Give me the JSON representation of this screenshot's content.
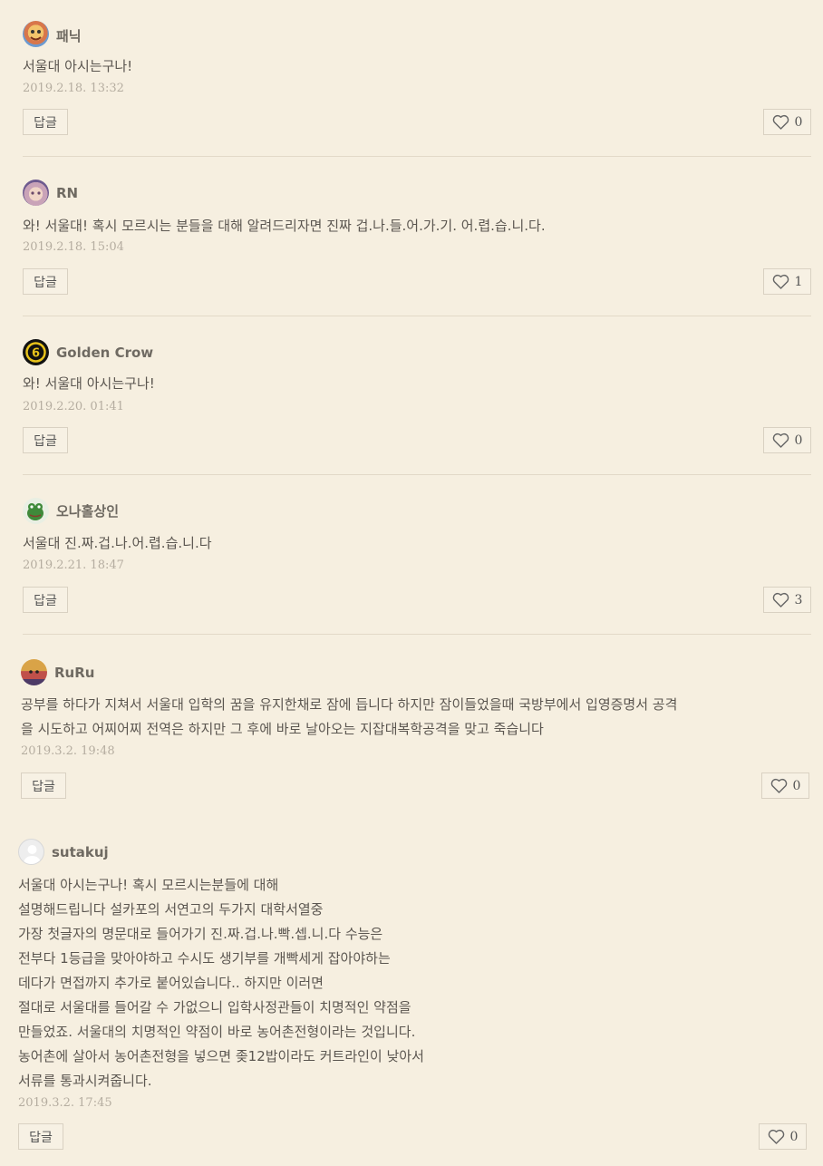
{
  "comments": [
    {
      "author": "패닉",
      "avatar_icon": "cartoon-character-avatar",
      "text": "서울대 아시는구나!",
      "time": "2019.2.18. 13:32",
      "reply_label": "답글",
      "likes": "0"
    },
    {
      "author": "RN",
      "avatar_icon": "anime-character-avatar",
      "text": "와! 서울대! 혹시 모르시는 분들을 대해 알려드리자면 진짜 겁.나.들.어.가.기. 어.렵.습.니.다.",
      "time": "2019.2.18. 15:04",
      "reply_label": "답글",
      "likes": "1"
    },
    {
      "author": "Golden Crow",
      "avatar_icon": "rainbow-six-logo-avatar",
      "text": "와! 서울대 아시는구나!",
      "time": "2019.2.20. 01:41",
      "reply_label": "답글",
      "likes": "0"
    },
    {
      "author": "오나홀상인",
      "avatar_icon": "frog-avatar",
      "text": "서울대 진.짜.겁.나.어.렵.습.니.다",
      "time": "2019.2.21. 18:47",
      "reply_label": "답글",
      "likes": "3"
    },
    {
      "author": "RuRu",
      "avatar_icon": "game-character-avatar",
      "text": "공부를 하다가 지쳐서 서울대 입학의 꿈을 유지한채로 잠에 듭니다 하지만 잠이들었을때 국방부에서 입영증명서 공격\n을 시도하고 어찌어찌 전역은 하지만 그 후에 바로 날아오는 지잡대복학공격을 맞고 죽습니다",
      "time": "2019.3.2. 19:48",
      "reply_label": "답글",
      "likes": "0"
    },
    {
      "author": "sutakuj",
      "avatar_icon": "default-user-avatar",
      "text": "서울대 아시는구나! 혹시 모르시는분들에 대해\n설명해드립니다 설카포의 서연고의 두가지 대학서열중\n가장 첫글자의 명문대로 들어가기 진.짜.겁.나.빡.셉.니.다 수능은\n전부다 1등급을 맞아야하고 수시도 생기부를 개빡세게 잡아야하는\n데다가 면접까지 추가로 붙어있습니다.. 하지만 이러면\n절대로 서울대를 들어갈 수 가없으니 입학사정관들이 치명적인 약점을\n만들었죠. 서울대의 치명적인 약점이 바로 농어촌전형이라는 것입니다.\n농어촌에 살아서 농어촌전형을 넣으면 좆12밥이라도 커트라인이 낮아서\n서류를 통과시켜줍니다.",
      "time": "2019.3.2. 17:45",
      "reply_label": "답글",
      "likes": "0"
    }
  ]
}
